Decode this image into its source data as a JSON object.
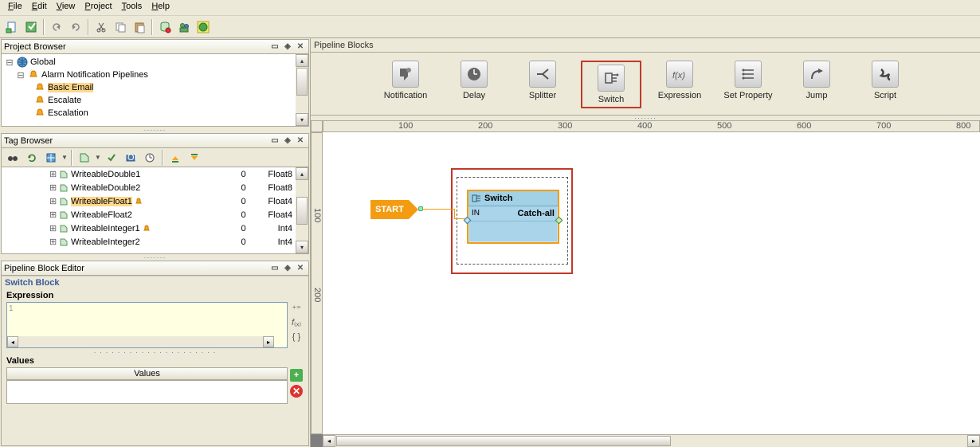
{
  "menu": {
    "file": "File",
    "edit": "Edit",
    "view": "View",
    "project": "Project",
    "tools": "Tools",
    "help": "Help"
  },
  "panels": {
    "project": "Project Browser",
    "tag": "Tag Browser",
    "pbe": "Pipeline Block Editor",
    "pipeline": "Pipeline Blocks"
  },
  "projectTree": [
    {
      "indent": 0,
      "glyph": "-",
      "icon": "globe",
      "label": "Global"
    },
    {
      "indent": 1,
      "glyph": "-",
      "icon": "bell",
      "label": "Alarm Notification Pipelines"
    },
    {
      "indent": 2,
      "glyph": "",
      "icon": "bell",
      "label": "Basic Email",
      "selected": true
    },
    {
      "indent": 2,
      "glyph": "",
      "icon": "bell",
      "label": "Escalate"
    },
    {
      "indent": 2,
      "glyph": "",
      "icon": "bell",
      "label": "Escalation"
    }
  ],
  "tags": [
    {
      "name": "WriteableDouble1",
      "value": "0",
      "type": "Float8"
    },
    {
      "name": "WriteableDouble2",
      "value": "0",
      "type": "Float8"
    },
    {
      "name": "WriteableFloat1",
      "value": "0",
      "type": "Float4",
      "selected": true,
      "bell": true
    },
    {
      "name": "WriteableFloat2",
      "value": "0",
      "type": "Float4"
    },
    {
      "name": "WriteableInteger1",
      "value": "0",
      "type": "Int4",
      "bell": true
    },
    {
      "name": "WriteableInteger2",
      "value": "0",
      "type": "Int4"
    }
  ],
  "pbe": {
    "group": "Switch Block",
    "expr": "Expression",
    "values": "Values",
    "valuesHead": "Values",
    "line": "1"
  },
  "palette": [
    {
      "id": "notification",
      "label": "Notification"
    },
    {
      "id": "delay",
      "label": "Delay"
    },
    {
      "id": "splitter",
      "label": "Splitter"
    },
    {
      "id": "switch",
      "label": "Switch",
      "selected": true
    },
    {
      "id": "expression",
      "label": "Expression"
    },
    {
      "id": "setproperty",
      "label": "Set Property"
    },
    {
      "id": "jump",
      "label": "Jump"
    },
    {
      "id": "script",
      "label": "Script"
    }
  ],
  "canvas": {
    "start": "START",
    "switch": {
      "title": "Switch",
      "in": "IN",
      "out": "Catch-all"
    },
    "rulerH": [
      "100",
      "200",
      "300",
      "400",
      "500",
      "600",
      "700",
      "800"
    ],
    "rulerV": [
      "100",
      "200"
    ]
  }
}
